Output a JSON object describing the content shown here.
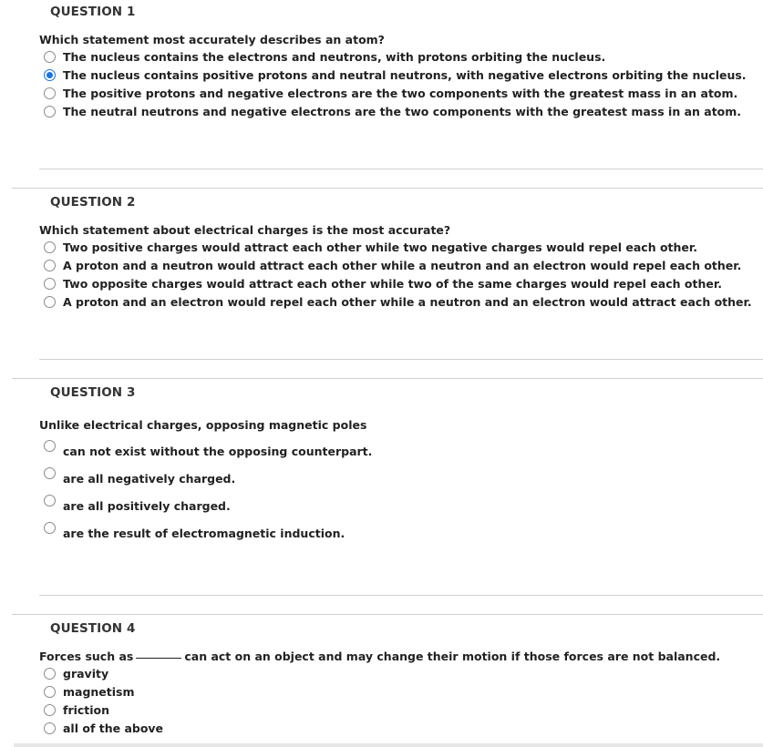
{
  "questions": [
    {
      "title": "QUESTION 1",
      "prompt": "Which statement most accurately describes an atom?",
      "options": [
        {
          "label": "The nucleus contains the electrons and neutrons, with protons orbiting the nucleus.",
          "selected": false
        },
        {
          "label": "The nucleus contains positive protons and neutral neutrons, with negative electrons orbiting the nucleus.",
          "selected": true
        },
        {
          "label": "The positive protons and negative electrons are the two components with the greatest mass in an atom.",
          "selected": false
        },
        {
          "label": "The neutral neutrons and negative electrons are the two components with the greatest mass in an atom.",
          "selected": false
        }
      ]
    },
    {
      "title": "QUESTION 2",
      "prompt": "Which statement about electrical charges is the most accurate?",
      "options": [
        {
          "label": "Two positive charges would attract each other while two negative charges would repel each other.",
          "selected": false
        },
        {
          "label": "A proton and a neutron would attract each other while a neutron and an electron would repel each other.",
          "selected": false
        },
        {
          "label": "Two opposite charges would attract each other while two of the same charges would repel each other.",
          "selected": false
        },
        {
          "label": "A proton and an electron would repel each other while a neutron and an electron would attract each other.",
          "selected": false
        }
      ]
    },
    {
      "title": "QUESTION 3",
      "prompt": "Unlike electrical charges, opposing magnetic poles",
      "options": [
        {
          "label": "can not exist without the opposing counterpart.",
          "selected": false
        },
        {
          "label": "are all negatively charged.",
          "selected": false
        },
        {
          "label": "are all positively charged.",
          "selected": false
        },
        {
          "label": "are the result of electromagnetic induction.",
          "selected": false
        }
      ]
    },
    {
      "title": "QUESTION 4",
      "prompt_before": "Forces such as",
      "prompt_after": "can act on an object and may change their motion if those forces are not balanced.",
      "options": [
        {
          "label": "gravity",
          "selected": false
        },
        {
          "label": "magnetism",
          "selected": false
        },
        {
          "label": "friction",
          "selected": false
        },
        {
          "label": "all of the above",
          "selected": false
        }
      ]
    }
  ],
  "colors": {
    "accent": "#1a73e8",
    "rule": "#d0d0d0"
  }
}
